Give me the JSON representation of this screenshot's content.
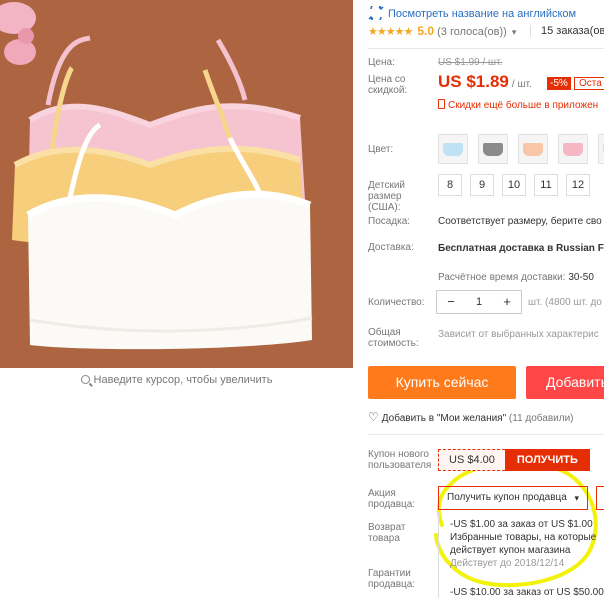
{
  "colors": {
    "accent": "#e62e04",
    "buy": "#ff7a1a",
    "cart": "#ff4747",
    "link": "#2b6fbf",
    "star": "#f5a623",
    "highlight": "#f2f20a"
  },
  "image": {
    "zoom_hint": "Наведите курсор, чтобы увеличить"
  },
  "header": {
    "translate_link": "Посмотреть название на английском",
    "stars": "★★★★★",
    "score": "5.0",
    "votes": "(3 голоса(ов))",
    "orders": "15 заказа(ов)"
  },
  "price": {
    "label_price": "Цена:",
    "old": "US $1.99 / шт.",
    "label_discounted": "Цена со скидкой:",
    "current": "US $1.89",
    "per": "/ шт.",
    "discount": "-5%",
    "badge": "Оста",
    "app_promo": "Скидки ещё больше в приложен"
  },
  "color": {
    "label": "Цвет:",
    "swatches": [
      {
        "name": "light-blue",
        "hex": "#bfe3f2"
      },
      {
        "name": "gray",
        "hex": "#8b8b8b"
      },
      {
        "name": "peach",
        "hex": "#f7c7a8"
      },
      {
        "name": "pink",
        "hex": "#f7b6c4"
      },
      {
        "name": "white",
        "hex": "#f8f8f8"
      }
    ]
  },
  "size": {
    "label": "Детский размер (США):",
    "options": [
      "8",
      "9",
      "10",
      "11",
      "12"
    ]
  },
  "fit": {
    "label": "Посадка:",
    "value": "Соответствует размеру, берите сво"
  },
  "shipping": {
    "label": "Доставка:",
    "title": "Бесплатная доставка в Russian Fe Mail",
    "time_label": "Расчётное время доставки:",
    "time_value": "30-50"
  },
  "quantity": {
    "label": "Количество:",
    "minus": "−",
    "value": "1",
    "plus": "+",
    "stock": "шт. (4800 шт. до"
  },
  "total": {
    "label": "Общая стоимость:",
    "value": "Зависит от выбранных характерис"
  },
  "actions": {
    "buy": "Купить сейчас",
    "cart": "Добавить"
  },
  "wishlist": {
    "icon": "♡",
    "label": "Добавить в \"Мои желания\"",
    "count": "(11 добавили)"
  },
  "coupons": {
    "new_user_label": "Купон нового пользователя",
    "new_user_amount": "US $4.00",
    "get_label": "ПОЛУЧИТЬ",
    "seller_label": "Акция продавца:",
    "seller_select": "Получить купон продавца",
    "return_label": "Возврат товара",
    "guarantee_label": "Гарантии продавца:",
    "deal1_line1": "-US $1.00 за заказ от US $1.00",
    "deal1_line2": "Избранные товары, на которые",
    "deal1_line3": "действует купон магазина",
    "deal1_expiry": "Действует до 2018/12/14",
    "deal2_line1": "-US $10.00 за заказ от US $50.00"
  }
}
